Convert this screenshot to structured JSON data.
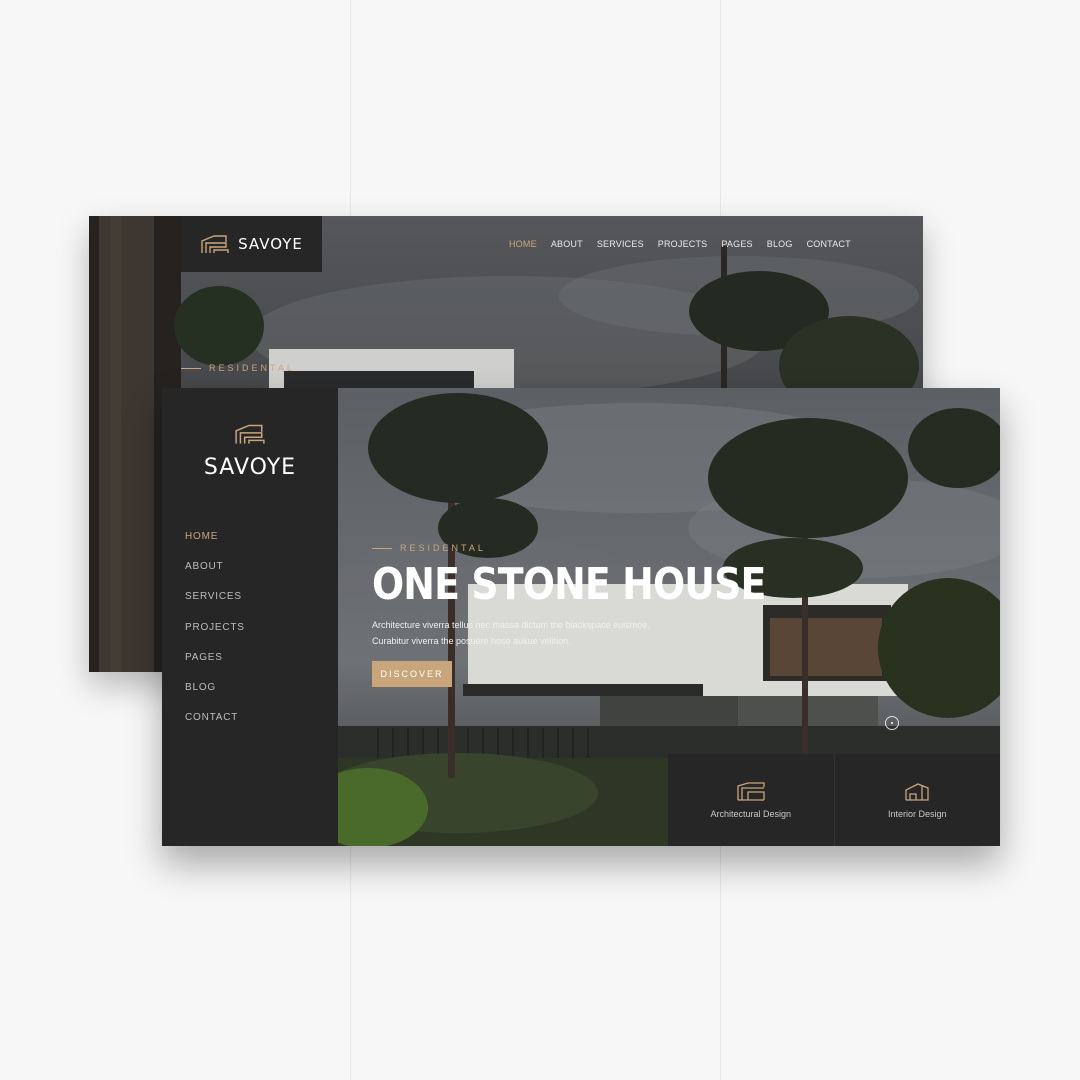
{
  "colors": {
    "accent": "#c9a57b",
    "panel": "#262626",
    "page_bg": "#f7f7f7"
  },
  "back": {
    "logo": {
      "icon": "house-logo-icon",
      "text": "SAVOYE"
    },
    "nav": [
      "HOME",
      "ABOUT",
      "SERVICES",
      "PROJECTS",
      "PAGES",
      "BLOG",
      "CONTACT"
    ],
    "active_nav": "HOME",
    "kicker": "RESIDENTAL"
  },
  "front": {
    "logo": {
      "icon": "house-logo-icon",
      "text": "SAVOYE"
    },
    "nav": [
      "HOME",
      "ABOUT",
      "SERVICES",
      "PROJECTS",
      "PAGES",
      "BLOG",
      "CONTACT"
    ],
    "active_nav": "HOME",
    "hero": {
      "kicker": "RESIDENTAL",
      "title": "ONE STONE HOUSE",
      "desc_line1": "Architecture viverra tellus nec massa dictum the blackspace euismoe.",
      "desc_line2": "Curabitur viverra the posuere hose aukue velition.",
      "button": "DISCOVER"
    },
    "services": [
      {
        "icon": "building-icon",
        "label": "Architectural Design"
      },
      {
        "icon": "interior-icon",
        "label": "Interior Design"
      }
    ]
  }
}
